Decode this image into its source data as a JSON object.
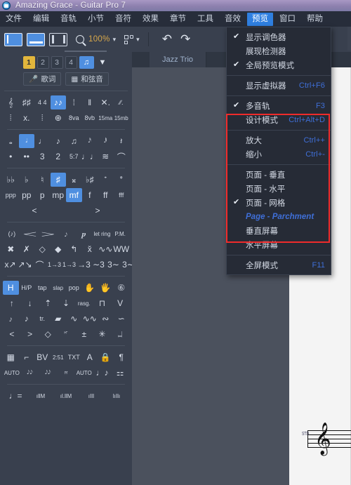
{
  "window": {
    "title": "Amazing Grace - Guitar Pro 7",
    "app_icon": "guitar-pro-logo-icon"
  },
  "menubar": {
    "items": [
      {
        "label": "文件",
        "active": false
      },
      {
        "label": "编辑",
        "active": false
      },
      {
        "label": "音轨",
        "active": false
      },
      {
        "label": "小节",
        "active": false
      },
      {
        "label": "音符",
        "active": false
      },
      {
        "label": "效果",
        "active": false
      },
      {
        "label": "章节",
        "active": false
      },
      {
        "label": "工具",
        "active": false
      },
      {
        "label": "音效",
        "active": false
      },
      {
        "label": "预览",
        "active": true
      },
      {
        "label": "窗口",
        "active": false
      },
      {
        "label": "帮助",
        "active": false
      }
    ]
  },
  "toolbar": {
    "view_buttons": [
      {
        "name": "view-vertical-split",
        "selected": true
      },
      {
        "name": "view-horizontal-split",
        "selected": true
      },
      {
        "name": "view-single-pane",
        "selected": false
      }
    ],
    "zoom_value": "100%",
    "zoom_icon": "magnifier-icon",
    "grid_icon": "layout-grid-icon",
    "undo_icon": "undo-arrow-icon",
    "redo_icon": "redo-arrow-icon"
  },
  "tabs": {
    "document": "Jazz Trio"
  },
  "tracks": {
    "numbers": [
      "1",
      "2",
      "3",
      "4"
    ],
    "selected_number": "1",
    "note_button_icon": "beamed-notes-icon",
    "filter_button_icon": "funnel-icon",
    "lyrics_label": "歌词",
    "lyrics_icon": "microphone-icon",
    "chord_label": "和弦音",
    "chord_icon": "chord-grid-icon"
  },
  "palette": {
    "rows": [
      {
        "name": "clef-key-time-row",
        "cells": [
          "𝄞",
          "♯♯",
          "4\n4",
          "♪♪",
          "⁞",
          "‖",
          "✕.",
          "∕∕."
        ],
        "selected_index": 3
      },
      {
        "name": "repeat-ottava-row",
        "cells": [
          "⦙",
          "x.",
          "⦙",
          "⊕",
          "8va",
          "8vb",
          "15ma",
          "15mb"
        ],
        "selected_index": -1
      },
      {
        "name": "note-duration-row",
        "cells": [
          "𝅝",
          "𝅗𝅥",
          "♩",
          "♪",
          "♫",
          "𝅘𝅥𝅰",
          "𝅘𝅥𝅱",
          "𝄽"
        ],
        "selected_index": 1
      },
      {
        "name": "tuplet-tie-row",
        "cells": [
          "•",
          "••",
          "3",
          "2",
          "5:7",
          "♩♩",
          "≋",
          "⌒"
        ],
        "selected_index": -1
      },
      {
        "name": "accidental-row",
        "cells": [
          "♭♭",
          "♭",
          "♮",
          "♯",
          "𝄪",
          "♭♯",
          "𝆴",
          "𝆵"
        ],
        "selected_index": 3
      },
      {
        "name": "dynamics-row",
        "cells": [
          "ppp",
          "pp",
          "p",
          "mp",
          "mf",
          "f",
          "ff",
          "fff"
        ],
        "selected_index": 4
      },
      {
        "name": "hairpin-row",
        "cells": [
          "<",
          ">"
        ],
        "selected_index": -1
      },
      {
        "name": "articulation-row",
        "cells": [
          "(♪)",
          "𝆒",
          "𝆓",
          "𝆕",
          "𝆏",
          "let ring",
          "P.M."
        ],
        "selected_index": -1
      },
      {
        "name": "technique-row",
        "cells": [
          "✖",
          "✗",
          "◇",
          "◆",
          "↰",
          "x̌",
          "∿∿",
          "WW"
        ],
        "selected_index": -1
      },
      {
        "name": "bend-row",
        "cells": [
          "x↗",
          "↗↘",
          "⌒",
          "1→3",
          "1→3",
          "→3",
          "∼3",
          "3∼",
          "3∼"
        ],
        "selected_index": -1
      },
      {
        "name": "hammer-slap-row",
        "cells": [
          "H",
          "H/P",
          "tap",
          "slap",
          "pop",
          "✋",
          "🖐",
          "⑥"
        ],
        "selected_index": 0
      },
      {
        "name": "stroke-row",
        "cells": [
          "↑",
          "↓",
          "⇡",
          "⇣",
          "rasg.",
          "⊓",
          "V"
        ],
        "selected_index": -1
      },
      {
        "name": "grace-trill-row",
        "cells": [
          "𝆔",
          "♪",
          "tr.",
          "▰",
          "∿",
          "∿∿",
          "∾",
          "∽"
        ],
        "selected_index": -1
      },
      {
        "name": "accent-row",
        "cells": [
          "<",
          ">",
          "◇",
          "𝆦",
          "±",
          "✳",
          "𝆶"
        ],
        "selected_index": -1
      },
      {
        "name": "misc-row",
        "cells": [
          "▦",
          "⌐",
          "BV",
          "2:51",
          "TXT",
          "A",
          "🔒",
          "¶"
        ],
        "selected_index": -1
      },
      {
        "name": "rhythm-row",
        "cells": [
          "AUTO",
          "𝅘𝅥𝅮𝅘𝅥𝅮",
          "𝅘𝅥𝅮𝅘𝅥𝅮",
          "𝄿𝄿",
          "AUTO",
          "♩♪",
          "⚏"
        ],
        "selected_index": -1
      },
      {
        "name": "tempo-row",
        "cells": [
          "♩=",
          "ıllM",
          "ıl.llM",
          "ıIlI",
          "lıIlı"
        ],
        "selected_index": -1
      }
    ]
  },
  "dropdown": {
    "name": "preview-menu",
    "items": [
      {
        "label": "显示调色器",
        "checked": true,
        "accel": "",
        "sep_after": false,
        "highlight": false
      },
      {
        "label": "展现检测器",
        "checked": false,
        "accel": "",
        "sep_after": false,
        "highlight": false
      },
      {
        "label": "全局预览模式",
        "checked": true,
        "accel": "",
        "sep_after": true,
        "highlight": false
      },
      {
        "label": "显示虚拟器",
        "checked": false,
        "accel": "Ctrl+F6",
        "sep_after": true,
        "highlight": false
      },
      {
        "label": "多音轨",
        "checked": true,
        "accel": "F3",
        "sep_after": false,
        "highlight": false
      },
      {
        "label": "设计模式",
        "checked": false,
        "accel": "Ctrl+Alt+D",
        "sep_after": true,
        "highlight": false
      },
      {
        "label": "放大",
        "checked": false,
        "accel": "Ctrl++",
        "sep_after": false,
        "highlight": false
      },
      {
        "label": "缩小",
        "checked": false,
        "accel": "Ctrl+-",
        "sep_after": true,
        "highlight": false
      },
      {
        "label": "页面 - 垂直",
        "checked": false,
        "accel": "",
        "sep_after": false,
        "highlight": false
      },
      {
        "label": "页面 - 水平",
        "checked": false,
        "accel": "",
        "sep_after": false,
        "highlight": false
      },
      {
        "label": "页面 - 网格",
        "checked": true,
        "accel": "",
        "sep_after": false,
        "highlight": false
      },
      {
        "label": "Page - Parchment",
        "checked": false,
        "accel": "",
        "sep_after": false,
        "highlight": true
      },
      {
        "label": "垂直屏幕",
        "checked": false,
        "accel": "",
        "sep_after": false,
        "highlight": false
      },
      {
        "label": "水平屏幕",
        "checked": false,
        "accel": "",
        "sep_after": true,
        "highlight": false
      },
      {
        "label": "全屏模式",
        "checked": false,
        "accel": "F11",
        "sep_after": false,
        "highlight": false
      }
    ]
  },
  "annotation": {
    "name": "red-highlight-box",
    "color": "#ef2b2b"
  },
  "score": {
    "clef_glyph": "𝄞",
    "tuning_label": "STD"
  },
  "colors": {
    "accent_blue": "#4f8fe0",
    "menu_highlight": "#2f7fe0",
    "accel_text": "#3f6fd8",
    "zoom_text": "#d8a84b",
    "panel_bg": "#39404e",
    "menu_bg": "#262b36",
    "titlebar": "#8d80ae",
    "track_gold": "#e2b63c",
    "annotation_red": "#ef2b2b"
  }
}
